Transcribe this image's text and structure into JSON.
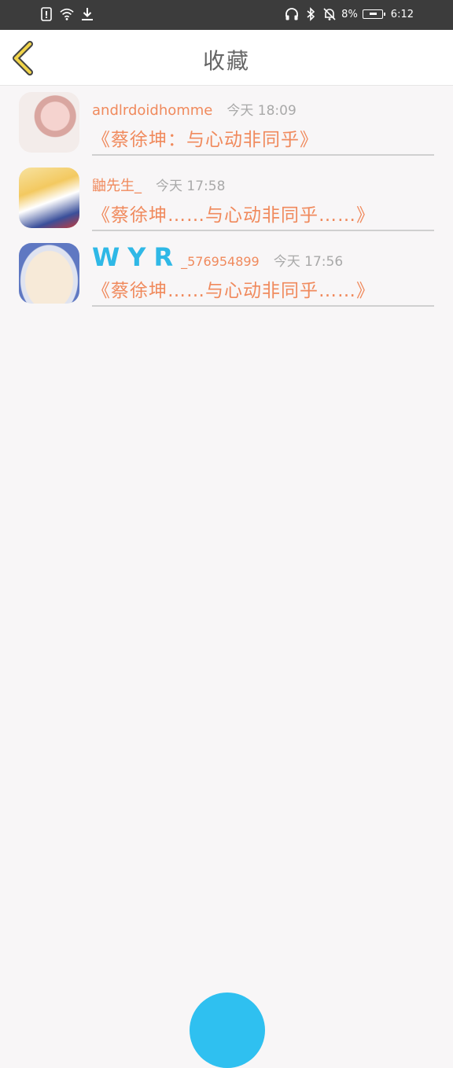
{
  "status_bar": {
    "battery_percent": "8%",
    "time": "6:12"
  },
  "header": {
    "title": "收藏"
  },
  "items": [
    {
      "name": "andlrdoidhomme",
      "time": "今天 18:09",
      "content": "《蔡徐坤：与心动非同乎》"
    },
    {
      "name": "鼬先生_",
      "time": "今天 17:58",
      "content": "《蔡徐坤……与心动非同乎……》"
    },
    {
      "name_brand": "WYR",
      "name_suffix": "_576954899",
      "time": "今天 17:56",
      "content": "《蔡徐坤……与心动非同乎……》"
    }
  ],
  "colors": {
    "accent": "#f08a5d",
    "brand_blue": "#2fb8e6",
    "back_chevron": "#f1d44a"
  }
}
